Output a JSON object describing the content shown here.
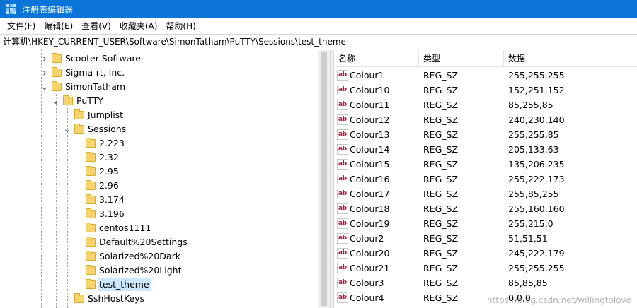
{
  "window": {
    "title": "注册表编辑器"
  },
  "menu": [
    "文件(F)",
    "编辑(E)",
    "查看(V)",
    "收藏夹(A)",
    "帮助(H)"
  ],
  "address": "计算机\\HKEY_CURRENT_USER\\Software\\SimonTatham\\PuTTY\\Sessions\\test_theme",
  "tree": [
    {
      "label": "Scooter Software",
      "expander": "collapsed",
      "selected": false
    },
    {
      "label": "Sigma-rt, Inc.",
      "expander": "collapsed",
      "selected": false
    },
    {
      "label": "SimonTatham",
      "expander": "expanded",
      "selected": false
    },
    {
      "label": "PuTTY",
      "expander": "expanded",
      "selected": false
    },
    {
      "label": "Jumplist",
      "expander": "none",
      "selected": false
    },
    {
      "label": "Sessions",
      "expander": "expanded",
      "selected": false
    },
    {
      "label": "2.223",
      "expander": "none",
      "selected": false
    },
    {
      "label": "2.32",
      "expander": "none",
      "selected": false
    },
    {
      "label": "2.95",
      "expander": "none",
      "selected": false
    },
    {
      "label": "2.96",
      "expander": "none",
      "selected": false
    },
    {
      "label": "3.174",
      "expander": "none",
      "selected": false
    },
    {
      "label": "3.196",
      "expander": "none",
      "selected": false
    },
    {
      "label": "centos1111",
      "expander": "none",
      "selected": false
    },
    {
      "label": "Default%20Settings",
      "expander": "none",
      "selected": false
    },
    {
      "label": "Solarized%20Dark",
      "expander": "none",
      "selected": false
    },
    {
      "label": "Solarized%20Light",
      "expander": "none",
      "selected": false
    },
    {
      "label": "test_theme",
      "expander": "none",
      "selected": true
    },
    {
      "label": "SshHostKeys",
      "expander": "none",
      "selected": false
    }
  ],
  "list": {
    "headers": {
      "name": "名称",
      "type": "类型",
      "data": "数据"
    },
    "icon": "ab",
    "rows": [
      {
        "name": "Colour1",
        "type": "REG_SZ",
        "data": "255,255,255"
      },
      {
        "name": "Colour10",
        "type": "REG_SZ",
        "data": "152,251,152"
      },
      {
        "name": "Colour11",
        "type": "REG_SZ",
        "data": "85,255,85"
      },
      {
        "name": "Colour12",
        "type": "REG_SZ",
        "data": "240,230,140"
      },
      {
        "name": "Colour13",
        "type": "REG_SZ",
        "data": "255,255,85"
      },
      {
        "name": "Colour14",
        "type": "REG_SZ",
        "data": "205,133,63"
      },
      {
        "name": "Colour15",
        "type": "REG_SZ",
        "data": "135,206,235"
      },
      {
        "name": "Colour16",
        "type": "REG_SZ",
        "data": "255,222,173"
      },
      {
        "name": "Colour17",
        "type": "REG_SZ",
        "data": "255,85,255"
      },
      {
        "name": "Colour18",
        "type": "REG_SZ",
        "data": "255,160,160"
      },
      {
        "name": "Colour19",
        "type": "REG_SZ",
        "data": "255,215,0"
      },
      {
        "name": "Colour2",
        "type": "REG_SZ",
        "data": "51,51,51"
      },
      {
        "name": "Colour20",
        "type": "REG_SZ",
        "data": "245,222,179"
      },
      {
        "name": "Colour21",
        "type": "REG_SZ",
        "data": "255,255,255"
      },
      {
        "name": "Colour3",
        "type": "REG_SZ",
        "data": "85,85,85"
      },
      {
        "name": "Colour4",
        "type": "REG_SZ",
        "data": "0,0,0"
      }
    ]
  },
  "watermark": "https://blog.csdn.net/willingtolove",
  "colors": {
    "titlebar": "#0a74d9",
    "selection": "#cce8ff",
    "folder": "#f6d46b"
  }
}
